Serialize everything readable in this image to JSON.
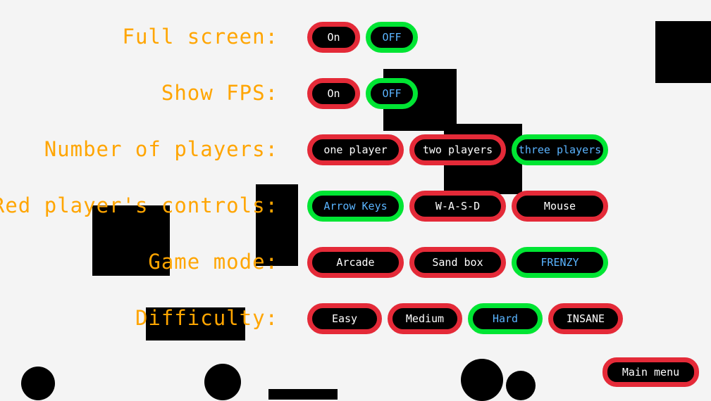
{
  "colors": {
    "label": "#ffa500",
    "unselected_border": "#e42a38",
    "selected_border": "#00e533",
    "selected_text": "#5ab4ff",
    "background": "#f4f4f4"
  },
  "settings": [
    {
      "label": "Full screen:",
      "options": [
        {
          "text": "On",
          "selected": false
        },
        {
          "text": "OFF",
          "selected": true
        }
      ]
    },
    {
      "label": "Show FPS:",
      "options": [
        {
          "text": "On",
          "selected": false
        },
        {
          "text": "OFF",
          "selected": true
        }
      ]
    },
    {
      "label": "Number of players:",
      "options": [
        {
          "text": "one player",
          "selected": false
        },
        {
          "text": "two players",
          "selected": false
        },
        {
          "text": "three players",
          "selected": true
        }
      ]
    },
    {
      "label": "Red player's controls:",
      "options": [
        {
          "text": "Arrow Keys",
          "selected": true
        },
        {
          "text": "W-A-S-D",
          "selected": false
        },
        {
          "text": "Mouse",
          "selected": false
        }
      ]
    },
    {
      "label": "Game mode:",
      "options": [
        {
          "text": "Arcade",
          "selected": false
        },
        {
          "text": "Sand box",
          "selected": false
        },
        {
          "text": "FRENZY",
          "selected": true
        }
      ]
    },
    {
      "label": "Difficulty:",
      "options": [
        {
          "text": "Easy",
          "selected": false
        },
        {
          "text": "Medium",
          "selected": false
        },
        {
          "text": "Hard",
          "selected": true
        },
        {
          "text": "INSANE",
          "selected": false
        }
      ]
    }
  ],
  "main_menu_label": "Main menu"
}
